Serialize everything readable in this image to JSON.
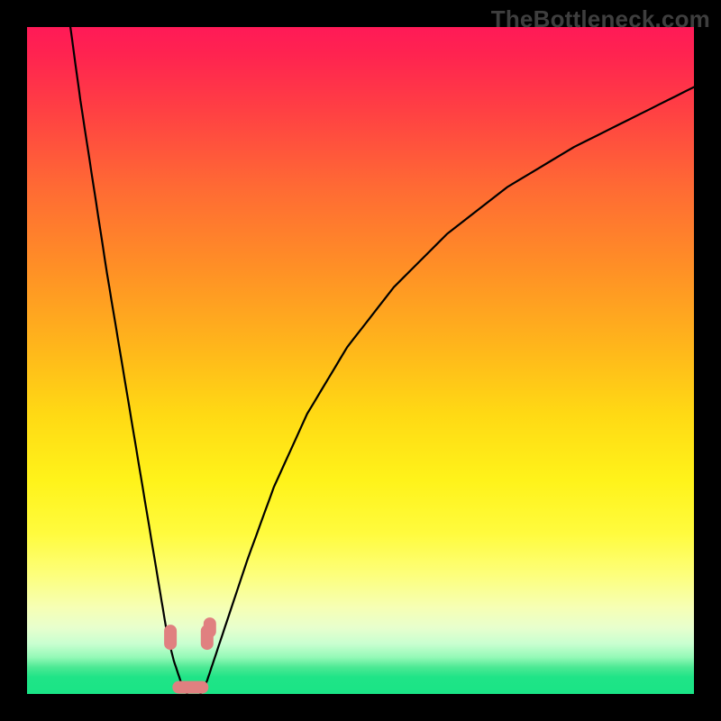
{
  "watermark_text": "TheBottleneck.com",
  "chart_data": {
    "type": "line",
    "title": "",
    "xlabel": "",
    "ylabel": "",
    "xlim": [
      0,
      100
    ],
    "ylim": [
      0,
      100
    ],
    "note": "V-shaped bottleneck curve over a red-to-green vertical gradient. The curve touches y≈0 near x≈22–26 and rises steeply to both sides. No axes, ticks, or numeric labels are shown; values are visually estimated from the geometry.",
    "series": [
      {
        "name": "left-branch",
        "x": [
          6.5,
          8,
          10,
          12,
          14,
          16,
          18,
          20,
          21,
          22,
          23,
          24
        ],
        "y": [
          100,
          89,
          76,
          63,
          51,
          39,
          27,
          15,
          9,
          5,
          2,
          0
        ]
      },
      {
        "name": "right-branch",
        "x": [
          26,
          27,
          28,
          30,
          33,
          37,
          42,
          48,
          55,
          63,
          72,
          82,
          92,
          100
        ],
        "y": [
          0,
          2,
          5,
          11,
          20,
          31,
          42,
          52,
          61,
          69,
          76,
          82,
          87,
          91
        ]
      }
    ],
    "markers": [
      {
        "name": "left-blob",
        "x": 21.5,
        "y": 8.5
      },
      {
        "name": "right-blob",
        "x": 27.0,
        "y": 8.5
      },
      {
        "name": "bottom-blob",
        "x": 24.5,
        "y": 1.0
      }
    ],
    "gradient_stops": [
      {
        "pct_from_top": 0,
        "color": "#ff1a57"
      },
      {
        "pct_from_top": 50,
        "color": "#ffd914"
      },
      {
        "pct_from_top": 82,
        "color": "#fdff7a"
      },
      {
        "pct_from_top": 100,
        "color": "#1ae486"
      }
    ]
  }
}
